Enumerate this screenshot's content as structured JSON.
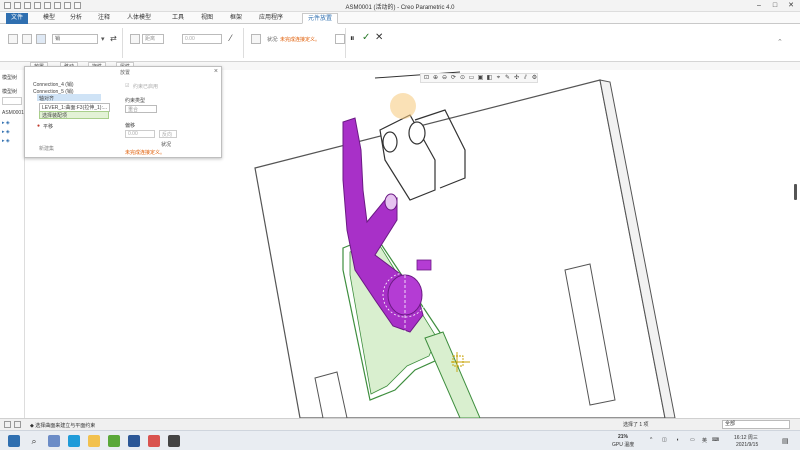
{
  "window": {
    "title": "ASM0001 (活动的) - Creo Parametric 4.0",
    "controls": [
      "–",
      "□",
      "✕"
    ]
  },
  "ribbon_tabs": [
    {
      "label": "文件",
      "type": "file"
    },
    {
      "label": "模型"
    },
    {
      "label": "分析"
    },
    {
      "label": "注释"
    },
    {
      "label": "人体模型"
    },
    {
      "label": "工具"
    },
    {
      "label": "视图"
    },
    {
      "label": "框架"
    },
    {
      "label": "应用程序"
    },
    {
      "label": "元件放置",
      "active": true
    }
  ],
  "dashboard": {
    "connection_type": "销",
    "constraint_type": "距离",
    "offset": "0.00",
    "status_label": "状况:",
    "status_text": "未完成连接定义。",
    "colors": {
      "status_text": "#e05a00",
      "accent": "#2f6fb0"
    }
  },
  "dashboard_tabs": [
    "放置",
    "移动",
    "挠性",
    "属性"
  ],
  "left_panel": {
    "header": "模型树",
    "search_label": "模型树",
    "root": "ASM0001"
  },
  "dialog": {
    "title": "放置",
    "tree": [
      {
        "label": "Connection_4 (销)"
      },
      {
        "label": "Connection_5 (销)"
      },
      {
        "label": "轴对齐",
        "selected": true
      },
      {
        "label": "LEVER_1:曲面:F3(拉伸_1):..."
      },
      {
        "label": "选择装配项",
        "highlight": true
      },
      {
        "label": "平移"
      }
    ],
    "new_set": "新建集",
    "enable_constraint": "约束已启用",
    "constraint_type_label": "约束类型",
    "constraint_type_value": "重合",
    "offset_label": "偏移",
    "offset_value": "0.00",
    "flip_button": "反向",
    "status_label": "状况",
    "status_text": "未完成连接定义。"
  },
  "status_bar": {
    "message": "◆ 选择曲面来建立与平面约束",
    "selection": "选择了 1 项",
    "filter": "全部"
  },
  "taskbar": {
    "search_icon": "search-icon",
    "gpu": "21%",
    "gpu_label": "GPU 温度",
    "language": "英",
    "time": "16:12 周三",
    "date": "2021/9/15"
  }
}
